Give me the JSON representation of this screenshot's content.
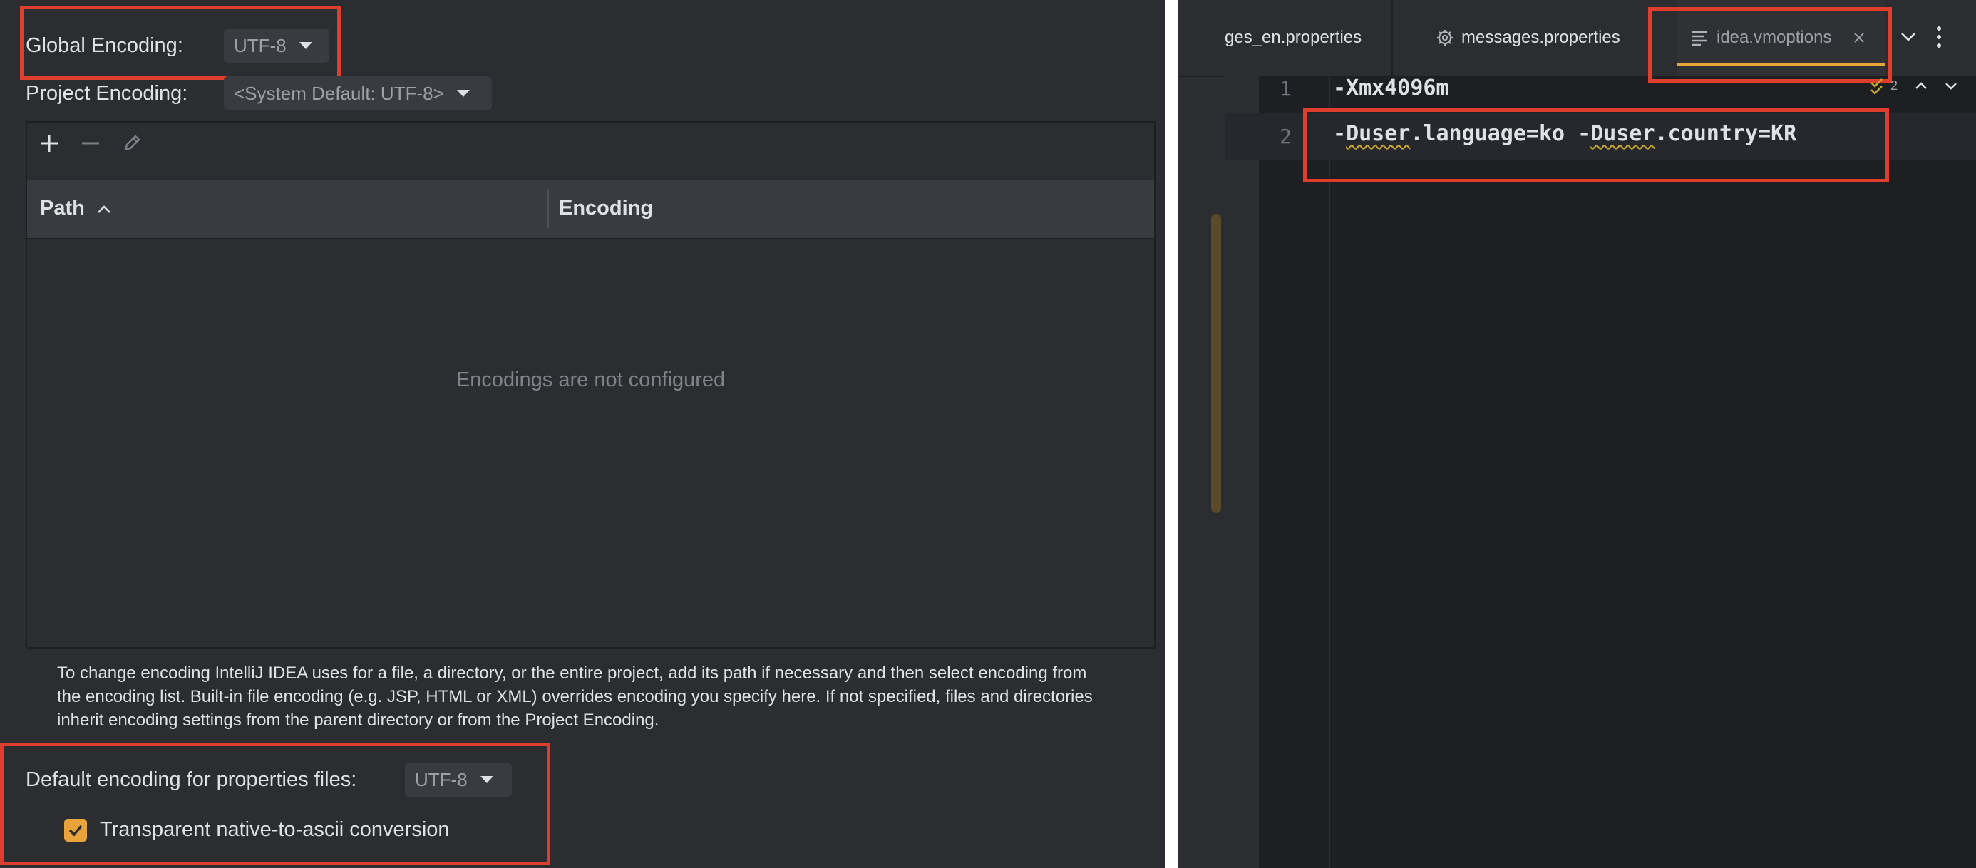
{
  "settings": {
    "global_encoding_label": "Global Encoding:",
    "global_encoding_value": "UTF-8",
    "project_encoding_label": "Project Encoding:",
    "project_encoding_value": "<System Default: UTF-8>",
    "table": {
      "columns": [
        "Path",
        "Encoding"
      ],
      "empty_text": "Encodings are not configured"
    },
    "help_text": "To change encoding IntelliJ IDEA uses for a file, a directory, or the entire project, add its path if necessary and then select encoding from the encoding list. Built-in file encoding (e.g. JSP, HTML or XML) overrides encoding you specify here. If not specified, files and directories inherit encoding settings from the parent directory or from the Project Encoding.",
    "properties_encoding_label": "Default encoding for properties files:",
    "properties_encoding_value": "UTF-8",
    "native_to_ascii_label": "Transparent native-to-ascii conversion",
    "native_to_ascii_checked": true
  },
  "editor": {
    "tabs": [
      {
        "label": "ges_en.properties"
      },
      {
        "label": "messages.properties"
      },
      {
        "label": "idea.vmoptions"
      }
    ],
    "inspection_count": "2",
    "lines": [
      {
        "number": "1",
        "text": "-Xmx4096m"
      },
      {
        "number": "2",
        "text": "-Duser.language=ko -Duser.country=KR"
      }
    ],
    "line2_parts": [
      "-",
      "Duser",
      ".language=ko -",
      "Duser",
      ".country=KR"
    ]
  },
  "colors": {
    "highlight_box": "#e03e2d",
    "checkbox": "#e8a33d",
    "active_tab_underline": "#e8a33d"
  }
}
